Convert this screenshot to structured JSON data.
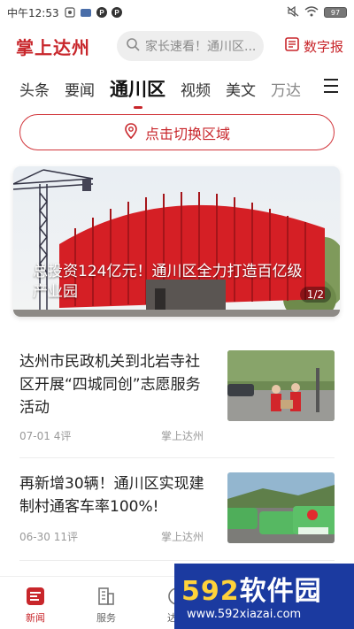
{
  "status_bar": {
    "time": "中午12:53",
    "battery": "97"
  },
  "header": {
    "logo": "掌上达州",
    "search_placeholder": "家长速看！通川区...",
    "digital_paper": "数字报"
  },
  "tabs": [
    {
      "label": "头条"
    },
    {
      "label": "要闻"
    },
    {
      "label": "通川区",
      "active": true
    },
    {
      "label": "视频"
    },
    {
      "label": "美文"
    },
    {
      "label": "万达"
    }
  ],
  "region_button": "点击切换区域",
  "banner": {
    "caption": "总投资124亿元！通川区全力打造百亿级产业园",
    "pager": "1/2"
  },
  "news": [
    {
      "title": "达州市民政机关到北岩寺社区开展“四城同创”志愿服务活动",
      "date": "07-01",
      "comments": "4评",
      "source": "掌上达州"
    },
    {
      "title": "再新增30辆！通川区实现建制村通客车率100%!",
      "date": "06-30",
      "comments": "11评",
      "source": "掌上达州"
    }
  ],
  "bottom_nav": [
    {
      "label": "新闻",
      "active": true
    },
    {
      "label": "服务"
    },
    {
      "label": "达州"
    },
    {
      "label": ""
    },
    {
      "label": ""
    }
  ],
  "watermark": {
    "brand_num": "592",
    "brand_text": "软件园",
    "url": "www.592xiazai.com"
  },
  "colors": {
    "accent": "#c8262b",
    "watermark_bg": "#1b3aa0"
  }
}
